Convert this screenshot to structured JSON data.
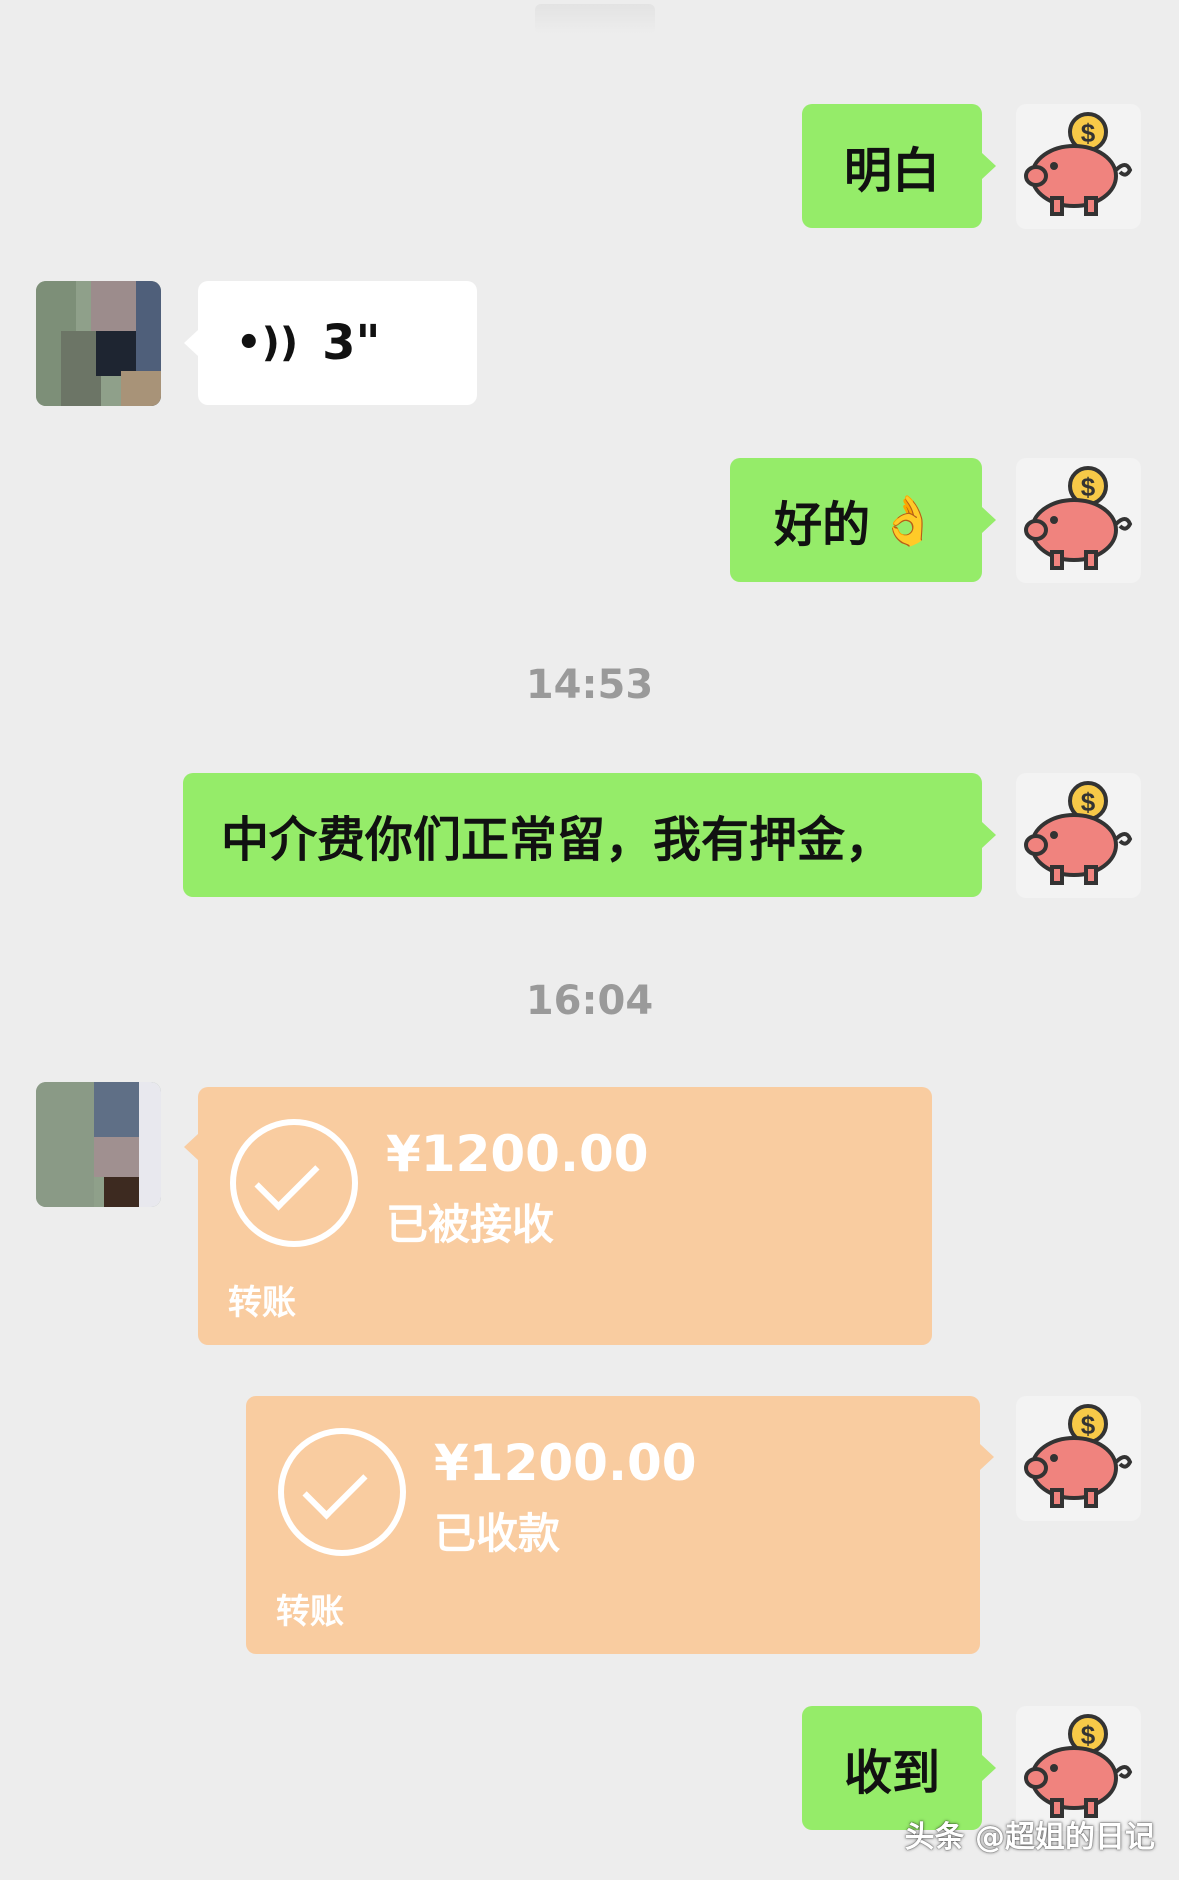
{
  "messages": {
    "m1": {
      "text": "明白"
    },
    "m2": {
      "voice_duration": "3\""
    },
    "m3": {
      "text": "好的",
      "emoji": "👌"
    },
    "ts1": "14:53",
    "m4": {
      "text": "中介费你们正常留，我有押金，"
    },
    "ts2": "16:04",
    "t1": {
      "amount": "¥1200.00",
      "status": "已被接收",
      "label": "转账"
    },
    "t2": {
      "amount": "¥1200.00",
      "status": "已收款",
      "label": "转账"
    },
    "m5": {
      "text": "收到"
    }
  },
  "watermark": "头条 @超姐的日记",
  "colors": {
    "background": "#ededed",
    "my_bubble": "#95ec69",
    "their_bubble": "#ffffff",
    "transfer": "#f9cca0",
    "timestamp": "#9a9a9a"
  },
  "icons": {
    "my_avatar": "piggy-bank-icon",
    "voice": "voice-wave-icon",
    "transfer_done": "check-circle-icon"
  }
}
